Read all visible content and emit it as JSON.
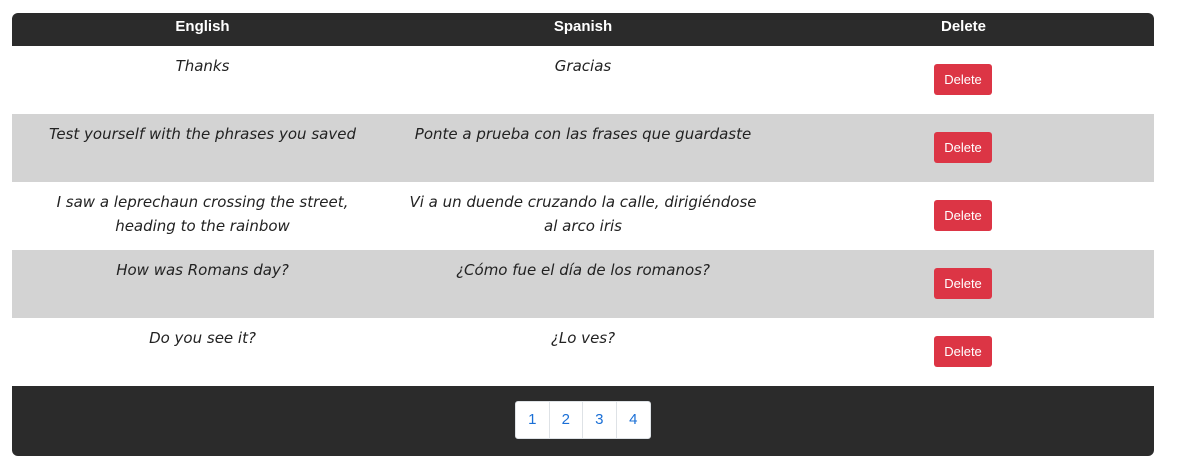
{
  "table": {
    "headers": {
      "english": "English",
      "spanish": "Spanish",
      "delete": "Delete"
    },
    "rows": [
      {
        "english": "Thanks",
        "spanish": "Gracias",
        "delete_label": "Delete"
      },
      {
        "english": "Test yourself with the phrases you saved",
        "spanish": "Ponte a prueba con las frases que guardaste",
        "delete_label": "Delete"
      },
      {
        "english": "I saw a leprechaun crossing the street, heading to the rainbow",
        "spanish": "Vi a un duende cruzando la calle, dirigiéndose al arco iris",
        "delete_label": "Delete"
      },
      {
        "english": "How was Romans day?",
        "spanish": "¿Cómo fue el día de los romanos?",
        "delete_label": "Delete"
      },
      {
        "english": "Do you see it?",
        "spanish": "¿Lo ves?",
        "delete_label": "Delete"
      }
    ]
  },
  "pagination": {
    "pages": [
      "1",
      "2",
      "3",
      "4"
    ]
  },
  "colors": {
    "header_bg": "#2b2b2b",
    "row_alt_bg": "#d3d3d3",
    "delete_button": "#dc3545",
    "page_link": "#1a6fd6"
  }
}
